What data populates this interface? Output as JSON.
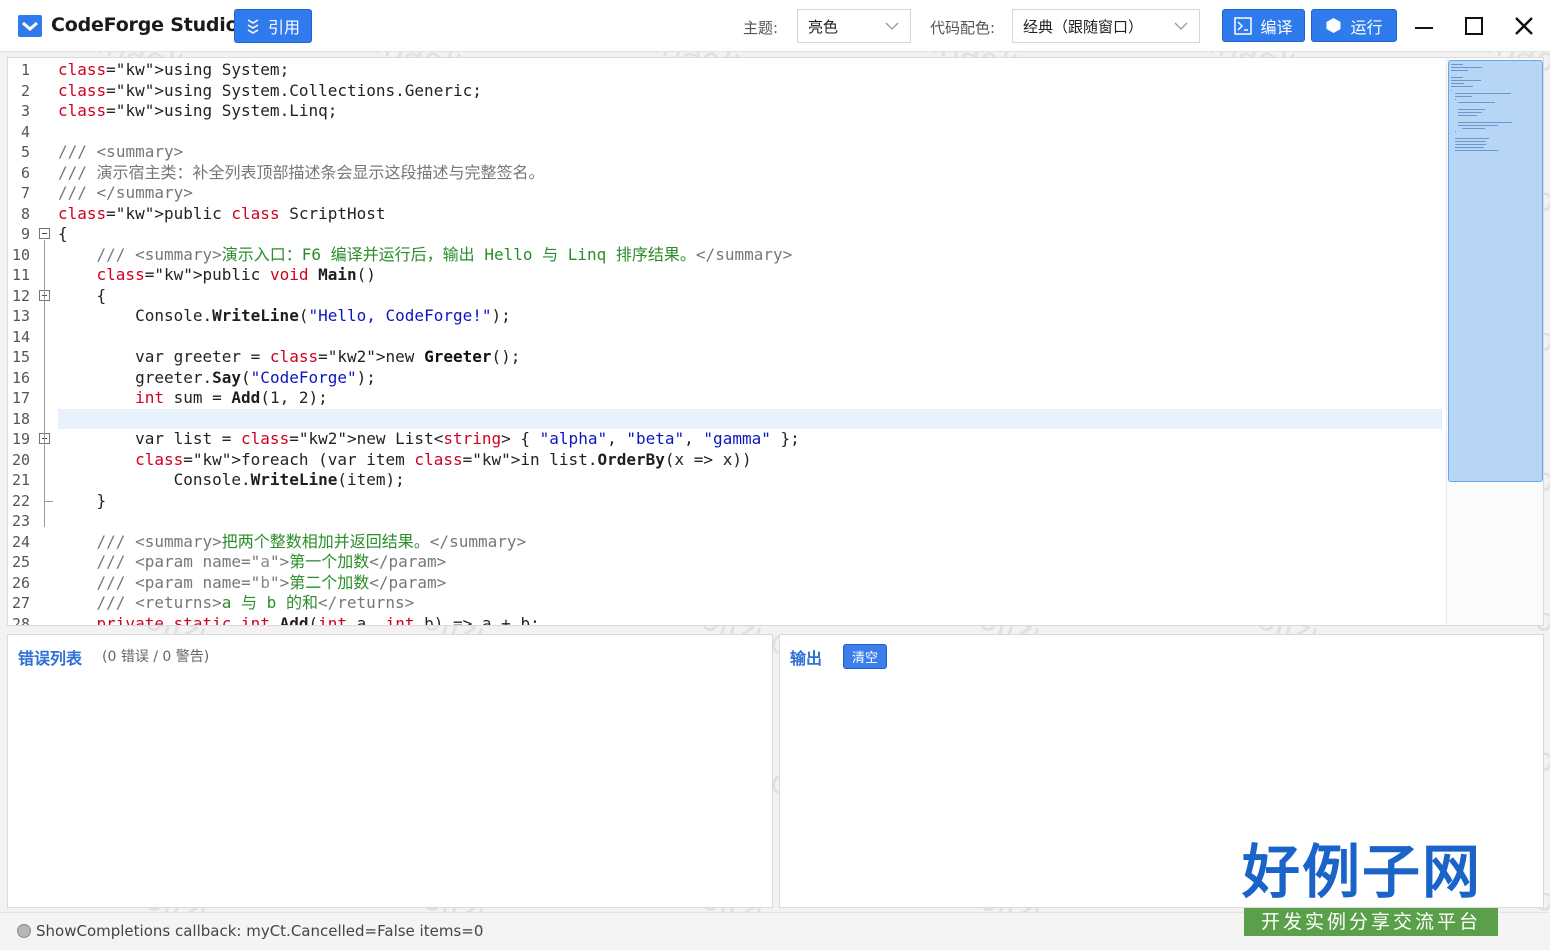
{
  "app": {
    "title": "CodeForge Studio"
  },
  "toolbar": {
    "ref_label": "引用",
    "theme_label": "主题:",
    "theme_value": "亮色",
    "scheme_label": "代码配色:",
    "scheme_value": "经典（跟随窗口）",
    "compile_label": "编译",
    "run_label": "运行"
  },
  "editor": {
    "line_numbers": [
      "1",
      "2",
      "3",
      "4",
      "5",
      "6",
      "7",
      "8",
      "9",
      "10",
      "11",
      "12",
      "13",
      "14",
      "15",
      "16",
      "17",
      "18",
      "19",
      "20",
      "21",
      "22",
      "23",
      "24",
      "25",
      "26",
      "27",
      "28"
    ],
    "current_line": 18,
    "lines": [
      "using System;",
      "using System.Collections.Generic;",
      "using System.Linq;",
      "",
      "/// <summary>",
      "/// 演示宿主类：补全列表顶部描述条会显示这段描述与完整签名。",
      "/// </summary>",
      "public class ScriptHost",
      "{",
      "    /// <summary>演示入口：F6 编译并运行后，输出 Hello 与 Linq 排序结果。</summary>",
      "    public void Main()",
      "    {",
      "        Console.WriteLine(\"Hello, CodeForge!\");",
      "",
      "        var greeter = new Greeter();",
      "        greeter.Say(\"CodeForge\");",
      "        int sum = Add(1, 2);",
      "",
      "        var list = new List<string> { \"alpha\", \"beta\", \"gamma\" };",
      "        foreach (var item in list.OrderBy(x => x))",
      "            Console.WriteLine(item);",
      "    }",
      "",
      "    /// <summary>把两个整数相加并返回结果。</summary>",
      "    /// <param name=\"a\">第一个加数</param>",
      "    /// <param name=\"b\">第二个加数</param>",
      "    /// <returns>a 与 b 的和</returns>",
      "    private static int Add(int a, int b) => a + b;"
    ]
  },
  "errors_panel": {
    "title": "错误列表",
    "summary": "(0 错误 / 0 警告)"
  },
  "output_panel": {
    "title": "输出",
    "clear_label": "清空"
  },
  "status": {
    "text": "ShowCompletions callback: myCt.Cancelled=False items=0"
  },
  "watermark": {
    "url_text": "www.haolizi.com",
    "logo_big": "好例子网",
    "logo_small": "开发实例分享交流平台"
  },
  "colors": {
    "accent": "#2f7bed",
    "panel_title": "#2f6fd6",
    "current_line": "#e7f1fb",
    "comment": "#2a8d2a",
    "keyword": "#0b1ea8"
  },
  "icons": {
    "app": "code-window-icon",
    "ref": "reference-icon",
    "compile": "compile-icon",
    "run": "run-icon"
  }
}
